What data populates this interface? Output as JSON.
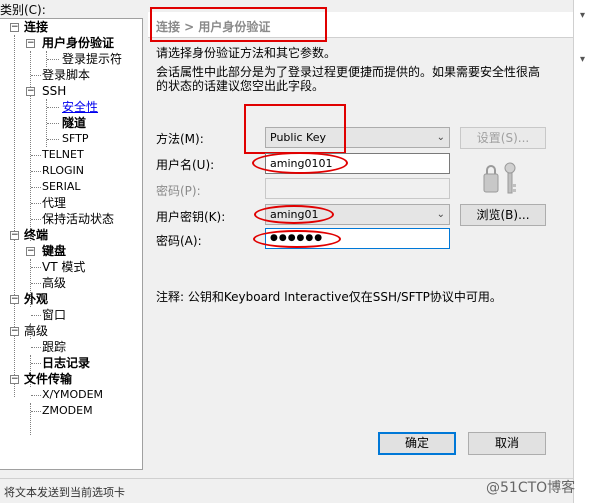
{
  "category_label": "类别(C):",
  "tree": {
    "items": [
      {
        "label": "连接",
        "bold": true
      },
      {
        "label": "用户身份验证",
        "bold": true
      },
      {
        "label": "登录提示符"
      },
      {
        "label": "登录脚本"
      },
      {
        "label": "SSH"
      },
      {
        "label": "安全性",
        "selected": true
      },
      {
        "label": "隧道",
        "bold": true
      },
      {
        "label": "SFTP"
      },
      {
        "label": "TELNET"
      },
      {
        "label": "RLOGIN"
      },
      {
        "label": "SERIAL"
      },
      {
        "label": "代理"
      },
      {
        "label": "保持活动状态"
      },
      {
        "label": "终端",
        "bold": true
      },
      {
        "label": "键盘",
        "bold": true
      },
      {
        "label": "VT 模式"
      },
      {
        "label": "高级"
      },
      {
        "label": "外观",
        "bold": true
      },
      {
        "label": "窗口"
      },
      {
        "label": "高级"
      },
      {
        "label": "跟踪"
      },
      {
        "label": "日志记录",
        "bold": true
      },
      {
        "label": "文件传输",
        "bold": true
      },
      {
        "label": "X/YMODEM"
      },
      {
        "label": "ZMODEM"
      }
    ]
  },
  "header": {
    "title": "连接 > 用户身份验证"
  },
  "description": {
    "line1": "请选择身份验证方法和其它参数。",
    "line2": "会话属性中此部分是为了登录过程更便捷而提供的。如果需要安全性很高",
    "line3": "的状态的话建议您空出此字段。"
  },
  "form": {
    "method_label": "方法(M):",
    "method_value": "Public Key",
    "settings_button": "设置(S)...",
    "username_label": "用户名(U):",
    "username_value": "aming0101",
    "password_label_disabled": "密码(P):",
    "password_value_disabled": "",
    "user_key_label": "用户密钥(K):",
    "user_key_value": "aming01",
    "browse_button": "浏览(B)...",
    "passphrase_label": "密码(A):",
    "passphrase_value": "●●●●●●"
  },
  "note": "注释: 公钥和Keyboard Interactive仅在SSH/SFTP协议中可用。",
  "buttons": {
    "ok": "确定",
    "cancel": "取消"
  },
  "status_text": "将文本发送到当前选项卡",
  "watermark": "@51CTO博客",
  "icons": {
    "key_icon": "key-icon",
    "combo_arrow": "chevron-down-icon"
  },
  "colors": {
    "annotation_red": "#e00000",
    "selected_link": "#0000ee",
    "focus_blue": "#0078d7"
  }
}
